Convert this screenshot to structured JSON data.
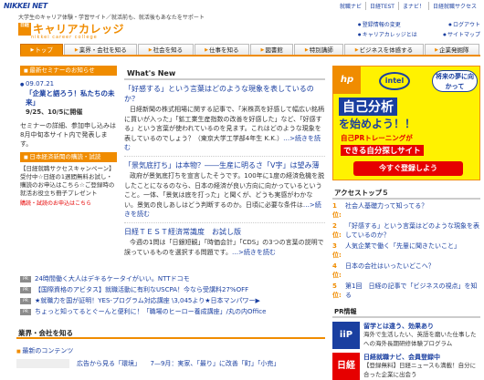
{
  "header": {
    "logo": "NIKKEI NET",
    "tagline": "大学生のキャリア体験・学習サイト／就活前も、就活後もあなたをサポート",
    "brand_mark": "日経",
    "brand_name": "キャリアカレッジ",
    "brand_sub": "nikkei career college",
    "top_links": [
      "就職ナビ",
      "日経TEST",
      "まナビ！",
      "日経就職サクセス"
    ],
    "user_links": [
      [
        "登録情報の変更",
        "ログアウト"
      ],
      [
        "キャリアカレッジとは",
        "サイトマップ"
      ]
    ]
  },
  "nav": [
    "トップ",
    "業界・会社を知る",
    "社会を知る",
    "仕事を知る",
    "図書館",
    "特別講師",
    "ビジネスを体感する",
    "企業発掘隊"
  ],
  "left": {
    "seminar_head": "最新セミナーのお知らせ",
    "seminar_date": "09.07.21",
    "seminar_title": "「企業と語ろう！私たちの未来」",
    "seminar_sub": "9/25、10/5に開催",
    "seminar_desc": "セミナーの詳細、参加申し込みは8月中旬本サイト内で発表します。",
    "ad_head": "日本経済新聞の購読・試読",
    "ad_text": "【日経就職サクセスキャンペーン】受付中☆日経の1週間無料お試し・購読のお申込はこちら☆ご登録時の就活お役立ち冊子プレゼント",
    "ad_link": "購読・試読のお申込はこちら"
  },
  "main": {
    "heading": "What's New",
    "more": "続きを読む",
    "articles": [
      {
        "title": "「好感する」という言葉はどのような現象を表しているのか？",
        "body": "日経新聞の株式相場に関する記事で、「米株高を好感して幅広い銘柄に買いが入った」「鉱工業生産指数の改善を好感した」など、「好感する」という言葉が使われているのを見ます。これはどのような現象を表しているのでしょう？（東京大学工学部4年生 K.K.）"
      },
      {
        "title": "「景気底打ち」は本物？――生産に明るさ「V字」は望み薄",
        "body": "政府が景気底打ちを宣言したそうです。100年に1度の経済危機を脱したことになるのなら、日本の経済が良い方向に向かっているということ。一体、「景気は底を打った」と聞くが、どうも実感がわかない。景気の良しあしはどう判断するのか。日頃に必要な条件は"
      },
      {
        "title": "日経ＴＥＳＴ経済常識度　お試し版",
        "body": "今週の1問は「日銀短観」「時価会計」「CDS」の3つの言葉の説明で誤っているものを選択する問題です。"
      }
    ]
  },
  "news": [
    {
      "tag": "PR",
      "text": "24時間働く大人はデキるケータイがいい。NTTドコモ"
    },
    {
      "tag": "PR",
      "text": "【国際資格のアビタス】就職活動に有利なUSCPA！今なら受講料27%OFF"
    },
    {
      "tag": "PR",
      "text": "★就職力を国が証明！YES-プログラム対応講座 \\3,045より★日本マンパワー▶"
    },
    {
      "tag": "PR",
      "text": "ちょっと知ってるとぐーんと便利に！「職場のヒーロー養成講座」/丸の内Office"
    }
  ],
  "corp": {
    "heading": "業界・会社を知る",
    "sub": "最新のコンテンツ",
    "row": "広告から見る「環境」　　7—9月：実家、「最り」に改善「町」「小売」"
  },
  "right": {
    "banner": {
      "hp": "hp",
      "intel": "intel",
      "bubble": "将来の夢に向かって",
      "line1": "自己分析",
      "line2": "を始めよう！！",
      "line3": "自己PRトレーニングが",
      "line4": "できる自分探しサイト",
      "button": "今すぐ登録しよう"
    },
    "access_head": "アクセストップ５",
    "ranks": [
      {
        "n": "1位:",
        "t": "社会人基礎力って知ってる？"
      },
      {
        "n": "2位:",
        "t": "「好感する」という言葉はどのような現象を表しているのか？"
      },
      {
        "n": "3位:",
        "t": "人気企業で働く「先輩に聞きたいこと」"
      },
      {
        "n": "4位:",
        "t": "日本の会社はいったいどこへ？"
      },
      {
        "n": "5位:",
        "t": "第1回　日経の記事で「ビジネスの視点」を知る"
      }
    ],
    "pr_head": "PR情報",
    "pr": [
      {
        "img": "iiP",
        "t": "留学とは違う、効果あり",
        "d": "海外で生活したい、英語を磨いた仕事したへの海外長期研修体験プログラム"
      },
      {
        "img": "日経",
        "t": "日経就職ナビ、会員登録中",
        "d": "【登録無料】日経ニュースも満載！自分に合った企業に出会う"
      }
    ]
  },
  "colors": {
    "accent": "#f08c00",
    "link": "#1a3fa0",
    "alert": "#e60000",
    "banner_bg": "#fff200"
  }
}
